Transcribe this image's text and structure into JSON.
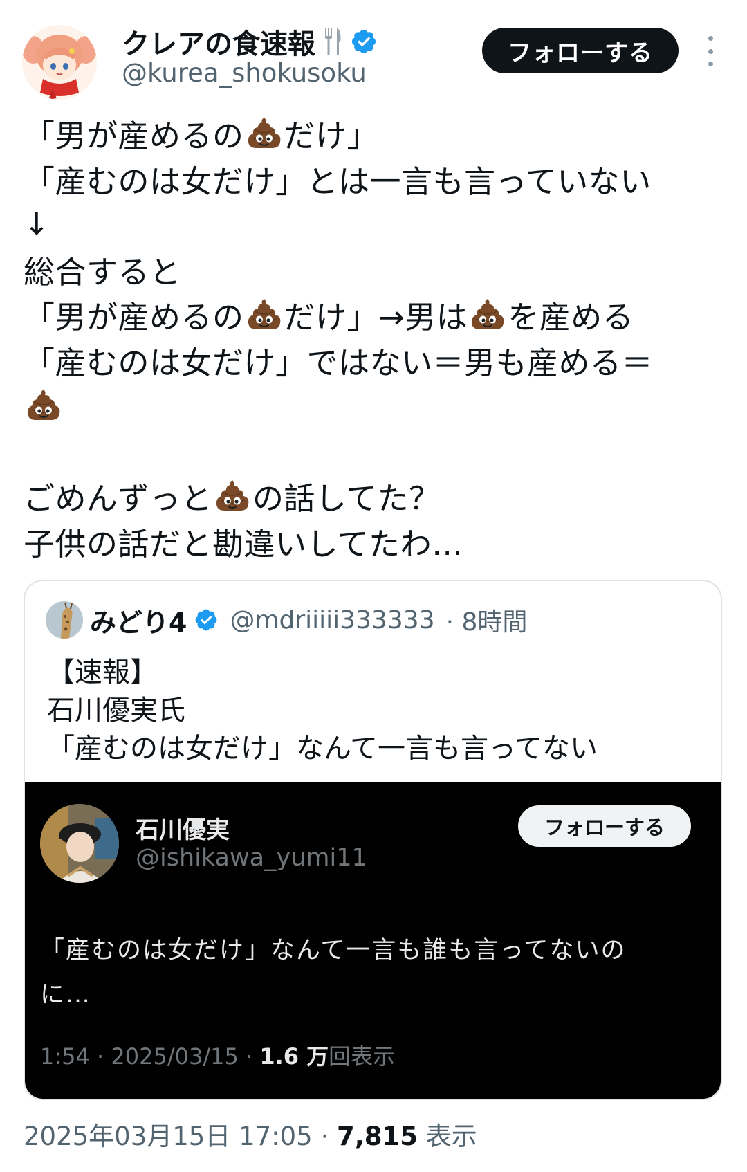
{
  "author": {
    "display_name": "クレアの食速報",
    "handle": "@kurea_shokusoku",
    "follow_label": "フォローする",
    "icons": [
      "fork-knife-icon",
      "verified-badge-icon",
      "more-options-icon"
    ]
  },
  "tweet": {
    "lines": [
      {
        "before": "「男が産めるの",
        "emoji": true,
        "after": "だけ」"
      },
      {
        "before": "「産むのは女だけ」とは一言も言っていない",
        "emoji": false,
        "after": ""
      },
      {
        "before": "↓",
        "emoji": false,
        "after": ""
      },
      {
        "before": "総合すると",
        "emoji": false,
        "after": ""
      },
      {
        "before": "「男が産めるの",
        "emoji": true,
        "after": "だけ」→男は",
        "emoji2": true,
        "after2": "を産める"
      },
      {
        "before": "「産むのは女だけ」ではない＝男も産める＝",
        "emoji": false,
        "after": ""
      },
      {
        "before": "",
        "emoji": true,
        "after": ""
      },
      {
        "before": "",
        "emoji": false,
        "after": ""
      },
      {
        "before": "ごめんずっと",
        "emoji": true,
        "after": "の話してた？"
      },
      {
        "before": "子供の話だと勘違いしてたわ…",
        "emoji": false,
        "after": ""
      }
    ],
    "emoji_name": "pile-of-poo-emoji"
  },
  "quote": {
    "display_name": "みどり4",
    "handle": "@mdriiiii333333",
    "time": "· 8時間",
    "lines": [
      "【速報】",
      "石川優実氏",
      "「産むのは女だけ」なんて一言も言ってない"
    ]
  },
  "embedded": {
    "display_name": "石川優実",
    "handle": "@ishikawa_yumi11",
    "follow_label": "フォローする",
    "lines": [
      "「産むのは女だけ」なんて一言も誰も言ってないの",
      "に…"
    ],
    "meta_prefix": "1:54 · 2025/03/15 · ",
    "views": "1.6 万",
    "views_label": "回表示"
  },
  "footer": {
    "timestamp": "2025年03月15日 17:05 · ",
    "views": "7,815",
    "views_label": " 表示"
  },
  "colors": {
    "text": "#0f1419",
    "secondary": "#536471",
    "verified": "#1d9bf0",
    "dark_bg": "#000000"
  }
}
